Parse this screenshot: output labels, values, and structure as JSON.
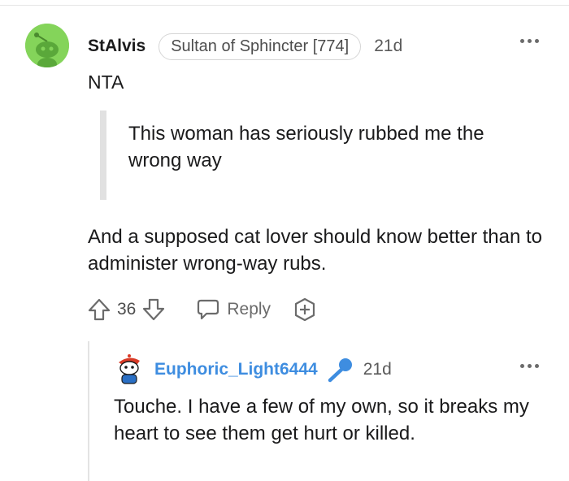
{
  "comment": {
    "username": "StAlvis",
    "flair": "Sultan of Sphincter [774]",
    "age": "21d",
    "verdict": "NTA",
    "quote": "This woman has seriously rubbed me the wrong way",
    "body": "And a supposed cat lover should know better than to administer wrong-way rubs.",
    "score": "36",
    "reply_label": "Reply",
    "avatar_color": "#84d45a"
  },
  "reply": {
    "username": "Euphoric_Light6444",
    "age": "21d",
    "body": "Touche. I have a few of my own, so it breaks my heart to see them get hurt or killed.",
    "username_color": "#3e8de0"
  },
  "icons": {
    "more": "more-options-icon",
    "upvote": "upvote-arrow-icon",
    "downvote": "downvote-arrow-icon",
    "reply": "speech-bubble-icon",
    "award": "award-plus-icon",
    "voice": "microphone-icon"
  }
}
